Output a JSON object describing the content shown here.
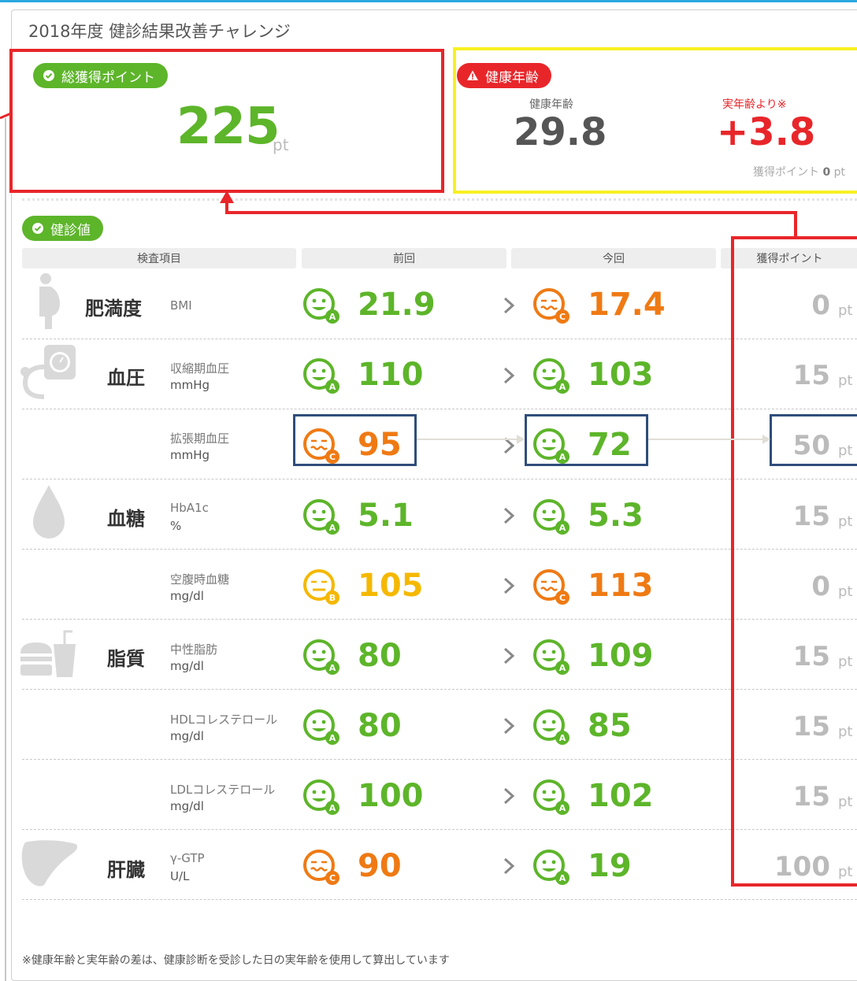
{
  "title": "2018年度 健診結果改善チャレンジ",
  "total": {
    "badge": "総獲得ポイント",
    "value": "225",
    "unit": "pt"
  },
  "health_age": {
    "badge": "健康年齢",
    "age_label": "健康年齢",
    "age_value": "29.8",
    "diff_label": "実年齢より※",
    "diff_value": "+3.8",
    "points_prefix": "獲得ポイント",
    "points_value": "0",
    "points_unit": "pt"
  },
  "section_badge": "健診値",
  "columns": [
    "検査項目",
    "前回",
    "今回",
    "獲得ポイント"
  ],
  "rows": [
    {
      "category": "肥満度",
      "icon": "body-icon",
      "name": "BMI",
      "unit": "",
      "prev": "21.9",
      "prev_grade": "A",
      "curr": "17.4",
      "curr_grade": "C",
      "points": "0",
      "pt": "pt"
    },
    {
      "category": "血圧",
      "icon": "blood-pressure-icon",
      "name": "収縮期血圧",
      "unit": "mmHg",
      "prev": "110",
      "prev_grade": "A",
      "curr": "103",
      "curr_grade": "A",
      "points": "15",
      "pt": "pt"
    },
    {
      "category": "",
      "icon": "",
      "name": "拡張期血圧",
      "unit": "mmHg",
      "prev": "95",
      "prev_grade": "C",
      "curr": "72",
      "curr_grade": "A",
      "points": "50",
      "pt": "pt"
    },
    {
      "category": "血糖",
      "icon": "blood-drop-icon",
      "name": "HbA1c",
      "unit": "%",
      "prev": "5.1",
      "prev_grade": "A",
      "curr": "5.3",
      "curr_grade": "A",
      "points": "15",
      "pt": "pt"
    },
    {
      "category": "",
      "icon": "",
      "name": "空腹時血糖",
      "unit": "mg/dl",
      "prev": "105",
      "prev_grade": "B",
      "curr": "113",
      "curr_grade": "C",
      "points": "0",
      "pt": "pt"
    },
    {
      "category": "脂質",
      "icon": "food-icon",
      "name": "中性脂肪",
      "unit": "mg/dl",
      "prev": "80",
      "prev_grade": "A",
      "curr": "109",
      "curr_grade": "A",
      "points": "15",
      "pt": "pt"
    },
    {
      "category": "",
      "icon": "",
      "name": "HDLコレステロール",
      "unit": "mg/dl",
      "prev": "80",
      "prev_grade": "A",
      "curr": "85",
      "curr_grade": "A",
      "points": "15",
      "pt": "pt"
    },
    {
      "category": "",
      "icon": "",
      "name": "LDLコレステロール",
      "unit": "mg/dl",
      "prev": "100",
      "prev_grade": "A",
      "curr": "102",
      "curr_grade": "A",
      "points": "15",
      "pt": "pt"
    },
    {
      "category": "肝臓",
      "icon": "liver-icon",
      "name": "γ-GTP",
      "unit": "U/L",
      "prev": "90",
      "prev_grade": "C",
      "curr": "19",
      "curr_grade": "A",
      "points": "100",
      "pt": "pt"
    }
  ],
  "footnote": "※健康年齢と実年齢の差は、健康診断を受診した日の実年齢を使用して算出しています",
  "colors": {
    "green": "#5db52a",
    "yellow": "#f5b800",
    "orange": "#ef7a14",
    "red": "#e8262a",
    "highlight_yellow": "#f8f020",
    "navy": "#2f4d7a"
  }
}
